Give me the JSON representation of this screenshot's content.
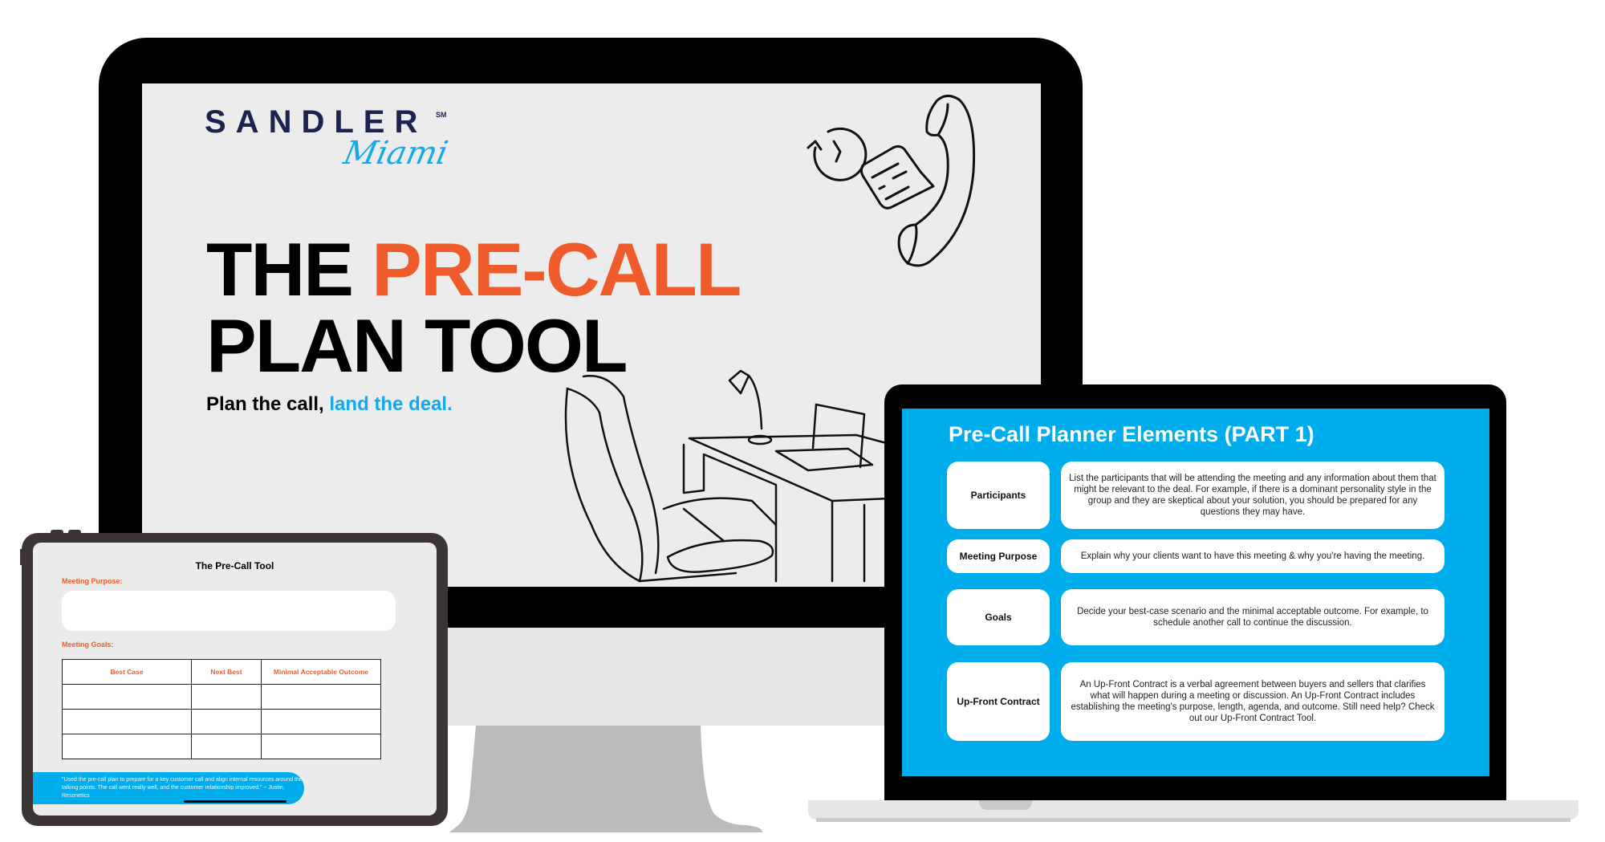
{
  "brand": {
    "name": "SANDLER",
    "service_mark": "SM",
    "location_script": "Miami",
    "colors": {
      "navy": "#1d2350",
      "orange": "#ef5b2b",
      "blue": "#00adec",
      "screen_gray": "#ececec",
      "device_black": "#000000",
      "tablet_frame": "#3d3535"
    }
  },
  "desktop": {
    "title_prefix": "THE ",
    "title_accent": "PRE-CALL",
    "title_line2": "PLAN TOOL",
    "tagline_prefix": "Plan the call, ",
    "tagline_accent": "land the deal.",
    "illustrations": [
      "clock-refresh-icon",
      "note-icon",
      "phone-handset-icon",
      "office-chair-desk-illustration"
    ]
  },
  "laptop": {
    "title": "Pre-Call Planner Elements (PART 1)",
    "rows": [
      {
        "label": "Participants",
        "description": "List the participants that will be attending the meeting and any information about them that might be relevant to the deal. For example, if there is a dominant personality style in the group and they are skeptical about your solution, you should be prepared for any questions they may have."
      },
      {
        "label": "Meeting Purpose",
        "description": "Explain why your clients want to have this meeting & why you're having the meeting."
      },
      {
        "label": "Goals",
        "description": "Decide your best-case scenario  and the minimal acceptable outcome. For example, to schedule another call to continue the discussion."
      },
      {
        "label": "Up-Front Contract",
        "description": "An Up-Front Contract is a verbal agreement between buyers and sellers that clarifies what will happen during a meeting or discussion. An Up-Front Contract includes establishing the meeting's purpose, length, agenda, and outcome. Still need help? Check out our Up-Front Contract Tool."
      }
    ]
  },
  "tablet": {
    "title": "The Pre-Call Tool",
    "purpose_label": "Meeting Purpose:",
    "purpose_value": "",
    "goals_label": "Meeting Goals:",
    "goals_table": {
      "columns": [
        "Best Case",
        "Next Best",
        "Minimal Acceptable Outcome"
      ],
      "rows": [
        [
          "",
          "",
          ""
        ],
        [
          "",
          "",
          ""
        ],
        [
          "",
          "",
          ""
        ]
      ]
    },
    "testimonial": "\"Used the pre-call plan to prepare for a key customer call and align internal resources around the talking points. The call went really well, and the customer relationship improved.\" ~ Justin, Resonetics"
  }
}
